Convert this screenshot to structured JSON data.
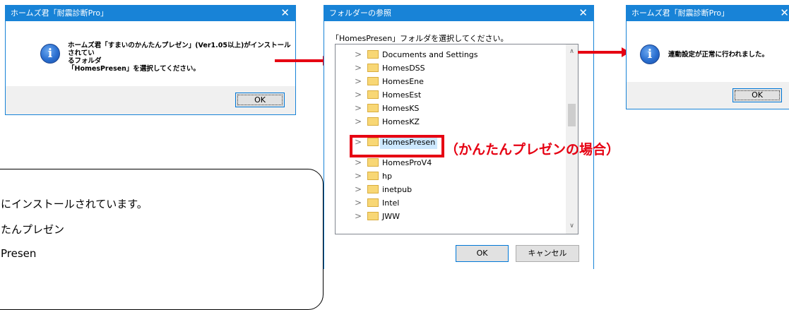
{
  "dialog1": {
    "title": "ホームズ君「耐震診断Pro」",
    "close": "✕",
    "message_line1": "ホームズ君「すまいのかんたんプレゼン」(Ver1.05以上)がインストールされてい",
    "message_line2": "るフォルダ",
    "message_line3": "「HomesPresen」を選択してください。",
    "ok_label": "OK"
  },
  "dialog2": {
    "title": "フォルダーの参照",
    "close": "✕",
    "instruction": "「HomesPresen」フォルダを選択してください。",
    "tree_items": [
      "Documents and Settings",
      "HomesDSS",
      "HomesEne",
      "HomesEst",
      "HomesKS",
      "HomesKZ",
      "HomesPresen",
      "HomesProV4",
      "hp",
      "inetpub",
      "Intel",
      "JWW"
    ],
    "selected_item": "HomesPresen",
    "ok_label": "OK",
    "cancel_label": "キャンセル"
  },
  "dialog3": {
    "title": "ホームズ君「耐震診断Pro」",
    "close": "✕",
    "message": "連動設定が正常に行われました。",
    "ok_label": "OK"
  },
  "annotation": {
    "text": "（かんたんプレゼンの場合）",
    "color": "#e60012"
  },
  "note": {
    "line1": "にインストールされています。",
    "line2": "たんプレゼン",
    "line3": "Presen"
  },
  "colors": {
    "titlebar": "#1883d7",
    "arrow": "#e60012"
  }
}
